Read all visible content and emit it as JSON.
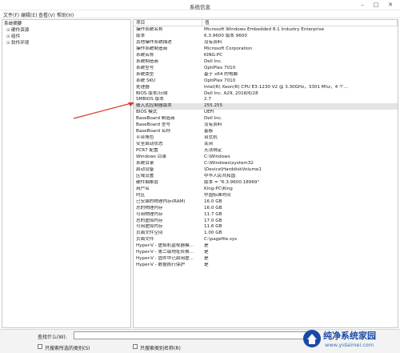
{
  "window": {
    "title": "系统信息"
  },
  "menu": [
    "文件(F)",
    "编辑(E)",
    "查看(V)",
    "帮助(H)"
  ],
  "tree": [
    {
      "label": "系统摘要",
      "expander": "",
      "indent": 0
    },
    {
      "label": "硬件资源",
      "expander": "⊞",
      "indent": 1
    },
    {
      "label": "组件",
      "expander": "⊞",
      "indent": 1
    },
    {
      "label": "软件环境",
      "expander": "⊞",
      "indent": 1
    }
  ],
  "table": {
    "headers": [
      "项目",
      "值"
    ],
    "selected_index": 12,
    "rows": [
      [
        "操作系统名称",
        "Microsoft Windows Embedded 8.1 Industry Enterprise"
      ],
      [
        "版本",
        "6.3.9600 版本 9600"
      ],
      [
        "其他操作系统描述",
        "没有资料"
      ],
      [
        "操作系统制造商",
        "Microsoft Corporation"
      ],
      [
        "系统名称",
        "KING-PC"
      ],
      [
        "系统制造商",
        "Dell Inc."
      ],
      [
        "系统型号",
        "OptiPlex 7010"
      ],
      [
        "系统类型",
        "基于 x64 的电脑"
      ],
      [
        "系统 SKU",
        "OptiPlex 7010"
      ],
      [
        "处理器",
        "Intel(R) Xeon(R) CPU E3-1230 V2 @ 3.30GHz，3301 Mhz，4 个..."
      ],
      [
        "BIOS 版本/日期",
        "Dell Inc. A29, 2018/6/28"
      ],
      [
        "SMBIOS 版本",
        "2.7"
      ],
      [
        "嵌入式控制器版本",
        "255.255"
      ],
      [
        "BIOS 模式",
        "UEFI"
      ],
      [
        "BaseBoard 制造商",
        "Dell Inc."
      ],
      [
        "BaseBoard 型号",
        "没有资料"
      ],
      [
        "BaseBoard 名称",
        "基板"
      ],
      [
        "平台角色",
        "台式机"
      ],
      [
        "安全启动状态",
        "关闭"
      ],
      [
        "PCR7 配置",
        "无法绑定"
      ],
      [
        "Windows 目录",
        "C:\\Windows"
      ],
      [
        "系统目录",
        "C:\\Windows\\system32"
      ],
      [
        "启动设备",
        "\\Device\\HarddiskVolume1"
      ],
      [
        "区域设置",
        "中华人民共和国"
      ],
      [
        "硬件抽象层",
        "版本 = \"6.3.9600.18969\""
      ],
      [
        "用户名",
        "King-PC\\King"
      ],
      [
        "时区",
        "中国标准时间"
      ],
      [
        "已安装的物理内存(RAM)",
        "16.0 GB"
      ],
      [
        "总的物理内存",
        "16.0 GB"
      ],
      [
        "可用物理内存",
        "11.7 GB"
      ],
      [
        "总的虚拟内存",
        "17.0 GB"
      ],
      [
        "可用虚拟内存",
        "11.6 GB"
      ],
      [
        "页面文件空间",
        "1.00 GB"
      ],
      [
        "页面文件",
        "C:\\pagefile.sys"
      ],
      [
        "Hyper-V - 虚拟机监视器模...",
        "是"
      ],
      [
        "Hyper-V - 第二级地址转换...",
        "是"
      ],
      [
        "Hyper-V - 固件中已启用虚...",
        "是"
      ],
      [
        "Hyper-V - 数据执行保护",
        "是"
      ]
    ]
  },
  "find": {
    "label": "查找什么(W):",
    "value": "",
    "only_selected_label": "只搜索所选的类别(S)",
    "only_names_label": "只搜索类别名称(R)"
  },
  "watermark": {
    "name": "纯净系统家园",
    "url": "www.yidaimei.com"
  },
  "colors": {
    "arrow": "#d93a2b",
    "selection": "#e4e4e4",
    "brand": "#1a4aa8"
  }
}
